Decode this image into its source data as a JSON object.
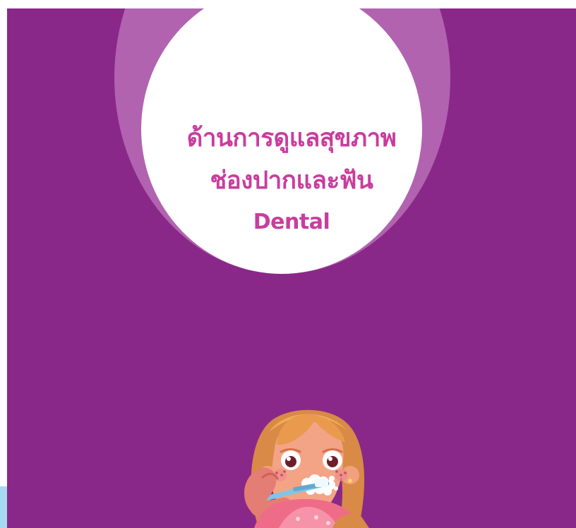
{
  "page": {
    "colors": {
      "background": "#8a2889",
      "circle": "#ffffff",
      "halo": "#b86db7",
      "title": "#c83d9e",
      "side_accent": "#a7d9f2"
    }
  },
  "hero": {
    "title_line_1": "ด้านการดูแลสุขภาพ",
    "title_line_2": "ช่องปากและฟัน",
    "title_line_3": "Dental"
  },
  "illustration": {
    "icon": "girl-brushing-teeth-icon"
  }
}
